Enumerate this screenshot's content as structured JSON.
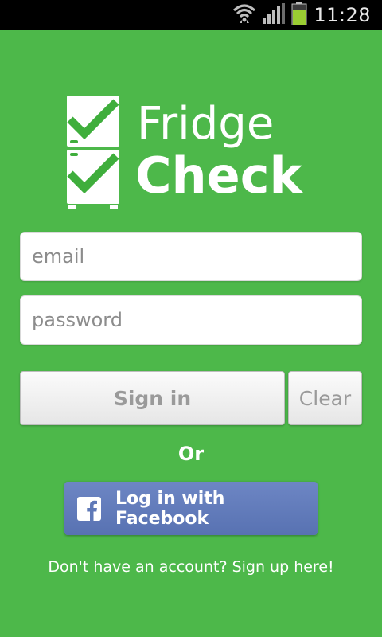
{
  "status_bar": {
    "time": "11:28",
    "icons": [
      "wifi-icon",
      "signal-icon",
      "battery-icon"
    ],
    "battery_color": "#9acd32"
  },
  "app": {
    "background_color": "#4db84a",
    "logo": {
      "word1": "Fridge",
      "word2": "Check",
      "check_color": "#3fae3c"
    },
    "email": {
      "placeholder": "email",
      "value": ""
    },
    "password": {
      "placeholder": "password",
      "value": ""
    },
    "sign_in_label": "Sign in",
    "clear_label": "Clear",
    "or_label": "Or",
    "facebook": {
      "label": "Log in with Facebook",
      "color": "#5f79b8"
    },
    "signup_text": "Don't have an account? Sign up here!"
  }
}
